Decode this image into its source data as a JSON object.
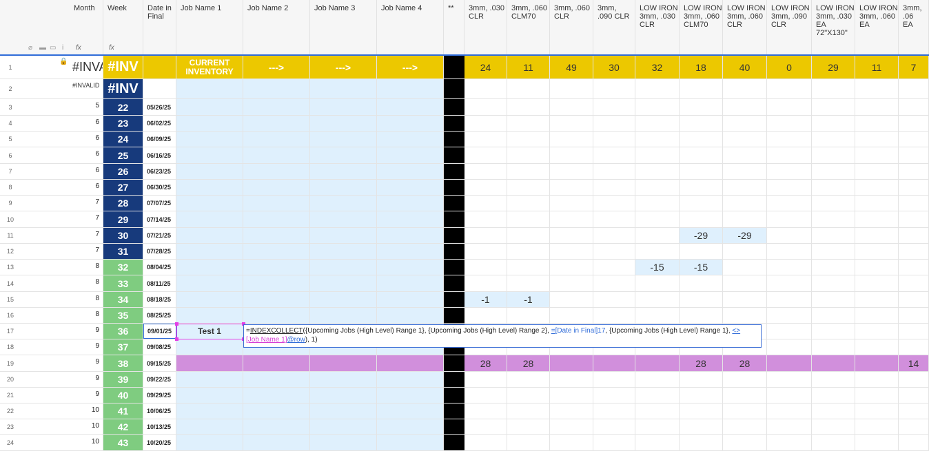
{
  "header": {
    "col_month": "Month",
    "col_week": "Week",
    "col_date": "Date in\nFinal",
    "col_job1": "Job Name 1",
    "col_job2": "Job Name 2",
    "col_job3": "Job Name 3",
    "col_job4": "Job Name 4",
    "col_sep": "**",
    "glass_cols": [
      "3mm, .030\nCLR",
      "3mm, .060\nCLM70",
      "3mm, .060\nCLR",
      "3mm,\n.090 CLR",
      "LOW IRON\n3mm, .030\nCLR",
      "LOW IRON\n3mm, .060\nCLM70",
      "LOW IRON\n3mm, .060\nCLR",
      "LOW IRON\n3mm, .090\nCLR",
      "LOW IRON\n3mm, .030\nEA\n72\"X130\"",
      "LOW IRON\n3mm, .060\nEA",
      "3mm, .06\nEA"
    ],
    "fx_label": "fx"
  },
  "row1": {
    "num": "1",
    "month": "#INVA",
    "week": "#INV",
    "current_inventory": "CURRENT\nINVENTORY",
    "arrow": "--->",
    "values": [
      "24",
      "11",
      "49",
      "30",
      "32",
      "18",
      "40",
      "0",
      "29",
      "11",
      "7"
    ]
  },
  "row2": {
    "num": "2",
    "month": "#INVALID",
    "week": "#INV"
  },
  "rows": [
    {
      "num": "3",
      "month": "5",
      "week": "22",
      "date": "05/26/25",
      "wc": "navy"
    },
    {
      "num": "4",
      "month": "6",
      "week": "23",
      "date": "06/02/25",
      "wc": "navy"
    },
    {
      "num": "5",
      "month": "6",
      "week": "24",
      "date": "06/09/25",
      "wc": "navy"
    },
    {
      "num": "6",
      "month": "6",
      "week": "25",
      "date": "06/16/25",
      "wc": "navy"
    },
    {
      "num": "7",
      "month": "6",
      "week": "26",
      "date": "06/23/25",
      "wc": "navy"
    },
    {
      "num": "8",
      "month": "6",
      "week": "27",
      "date": "06/30/25",
      "wc": "navy"
    },
    {
      "num": "9",
      "month": "7",
      "week": "28",
      "date": "07/07/25",
      "wc": "navy"
    },
    {
      "num": "10",
      "month": "7",
      "week": "29",
      "date": "07/14/25",
      "wc": "navy"
    },
    {
      "num": "11",
      "month": "7",
      "week": "30",
      "date": "07/21/25",
      "wc": "navy"
    },
    {
      "num": "12",
      "month": "7",
      "week": "31",
      "date": "07/28/25",
      "wc": "navy"
    },
    {
      "num": "13",
      "month": "8",
      "week": "32",
      "date": "08/04/25",
      "wc": "green"
    },
    {
      "num": "14",
      "month": "8",
      "week": "33",
      "date": "08/11/25",
      "wc": "green"
    },
    {
      "num": "15",
      "month": "8",
      "week": "34",
      "date": "08/18/25",
      "wc": "green"
    },
    {
      "num": "16",
      "month": "8",
      "week": "35",
      "date": "08/25/25",
      "wc": "green"
    },
    {
      "num": "17",
      "month": "9",
      "week": "36",
      "date": "09/01/25",
      "wc": "green",
      "job1": "Test 1"
    },
    {
      "num": "18",
      "month": "9",
      "week": "37",
      "date": "09/08/25",
      "wc": "green"
    },
    {
      "num": "19",
      "month": "9",
      "week": "38",
      "date": "09/15/25",
      "wc": "green",
      "purple": true
    },
    {
      "num": "20",
      "month": "9",
      "week": "39",
      "date": "09/22/25",
      "wc": "green"
    },
    {
      "num": "21",
      "month": "9",
      "week": "40",
      "date": "09/29/25",
      "wc": "green"
    },
    {
      "num": "22",
      "month": "10",
      "week": "41",
      "date": "10/06/25",
      "wc": "green"
    },
    {
      "num": "23",
      "month": "10",
      "week": "42",
      "date": "10/13/25",
      "wc": "green"
    },
    {
      "num": "24",
      "month": "10",
      "week": "43",
      "date": "10/20/25",
      "wc": "green"
    }
  ],
  "glass_values": {
    "11": {
      "5": "-29",
      "6": "-29"
    },
    "13": {
      "4": "-15",
      "5": "-15"
    },
    "15": {
      "0": "-1",
      "1": "-1"
    },
    "19": {
      "0": "28",
      "1": "28",
      "5": "28",
      "6": "28",
      "10": "14"
    }
  },
  "formula": {
    "eq": "=",
    "fn1": "INDEX",
    "fn2": "COLLECT",
    "p1": "({Upcoming Jobs (High Level) Range 1}, {Upcoming Jobs (High Level) Range 2}, ",
    "eq2": "=",
    "ref1": "[Date in Final]17",
    "p2": ", {Upcoming Jobs (High Level) Range 1}, ",
    "op": "<>",
    "ref2a": "[Job Name 1]",
    "ref2b": "@row",
    "p3": "), 1)"
  },
  "colors": {
    "navy": "#173a7c",
    "green": "#7fcc80",
    "yellow": "#ecc800",
    "light_blue": "#dff0fd",
    "purple": "#d18fdc",
    "black": "#000000"
  }
}
